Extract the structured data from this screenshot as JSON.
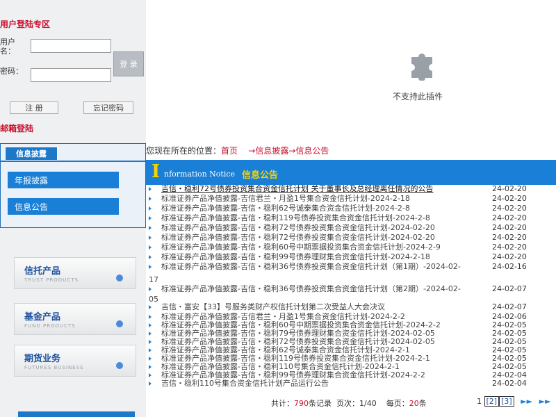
{
  "login": {
    "title": "用户登陆专区",
    "user_label": "用户名：",
    "pass_label": "密码：",
    "login_btn": "登 录",
    "register_btn": "注 册",
    "forgot_btn": "忘记密码",
    "mail_login": "邮箱登陆"
  },
  "plugin": {
    "message": "不支持此插件"
  },
  "sidebar": {
    "tab": "信息披露",
    "items": [
      {
        "label": "年报披露"
      },
      {
        "label": "信息公告"
      }
    ]
  },
  "products": [
    {
      "title": "信托产品",
      "subtitle": "TRUST PRODUCTS"
    },
    {
      "title": "基金产品",
      "subtitle": "FUND PRODUCTS"
    },
    {
      "title": "期货业务",
      "subtitle": "FUTURES BUSINESS"
    }
  ],
  "breadcrumb": {
    "prefix": "您现在所在的位置：",
    "home": "首页",
    "level1": "→信息披露",
    "level2": "→信息公告"
  },
  "notice": {
    "initial": "I",
    "en": "nformation Notice",
    "cn": "信息公告"
  },
  "notices": [
    {
      "title": "吉信・稳利72号债券投资集合资金信托计划 关于董事长及总经理离任情况的公告",
      "date": "24-02-20"
    },
    {
      "title": "标准证券产品净值披露-吉信君兰・月盈1号集合资金信托计划-2024-2-18",
      "date": "24-02-20"
    },
    {
      "title": "标准证券产品净值披露-吉信・稳利62号诚泰集合资金信托计划-2024-2-8",
      "date": "24-02-20"
    },
    {
      "title": "标准证券产品净值披露-吉信・稳利119号债券投资集合资金信托计划-2024-2-8",
      "date": "24-02-20"
    },
    {
      "title": "标准证券产品净值披露-吉信・稳利72号债券投资集合资金信托计划-2024-02-20",
      "date": "24-02-20"
    },
    {
      "title": "标准证券产品净值披露-吉信・稳利72号债券投资集合资金信托计划-2024-02-20",
      "date": "24-02-20"
    },
    {
      "title": "标准证券产品净值披露-吉信・稳利60号中期票据投资集合资金信托计划-2024-2-9",
      "date": "24-02-20"
    },
    {
      "title": "标准证券产品净值披露-吉信・稳利99号债券理财集合资金信托计划-2024-2-18",
      "date": "24-02-20"
    },
    {
      "title": "标准证券产品净值披露-吉信・稳利36号债券投资集合资金信托计划（第1期）-2024-02-",
      "date": "24-02-16"
    },
    {
      "title": "标准证券产品净值披露-吉信・稳利36号债券投资集合资金信托计划（第2期）-2024-02-",
      "date": "24-02-07"
    },
    {
      "title": "吉信・富安【33】号服务类财产权信托计划第二次受益人大会决议",
      "date": "24-02-07"
    },
    {
      "title": "标准证券产品净值披露-吉信君兰・月盈1号集合资金信托计划-2024-2-2",
      "date": "24-02-06"
    },
    {
      "title": "标准证券产品净值披露-吉信・稳利60号中期票据投资集合资金信托计划-2024-2-2",
      "date": "24-02-05"
    },
    {
      "title": "标准证券产品净值披露-吉信・稳利79号债券理财集合资金信托计划-2024-02-05",
      "date": "24-02-05"
    },
    {
      "title": "标准证券产品净值披露-吉信・稳利72号债券投资集合资金信托计划-2024-02-05",
      "date": "24-02-05"
    },
    {
      "title": "标准证券产品净值披露-吉信・稳利62号诚泰集合资金信托计划-2024-2-1",
      "date": "24-02-05"
    },
    {
      "title": "标准证券产品净值披露-吉信・稳利119号债券投资集合资金信托计划-2024-2-1",
      "date": "24-02-05"
    },
    {
      "title": "标准证券产品净值披露-吉信・稳利110号集合资金信托计划-2024-2-1",
      "date": "24-02-05"
    },
    {
      "title": "标准证券产品净值披露-吉信・稳利99号债券理财集合资金信托计划-2024-2-2",
      "date": "24-02-04"
    },
    {
      "title": "吉信・稳利110号集合资金信托计划产品运行公告",
      "date": "24-02-04"
    }
  ],
  "orphans": [
    "17",
    "05"
  ],
  "footer": {
    "total_prefix": "共计：",
    "total": "790",
    "total_suffix": "条记录",
    "page_prefix": "页次：",
    "page": "1/40",
    "per_prefix": "每页：",
    "per": "20",
    "per_suffix": "条",
    "pages": [
      "[2]",
      "[3]"
    ],
    "prev": "1",
    "next_icon": "►►",
    "last_icon": "►►"
  },
  "colors": {
    "accent": "#1a7fd6",
    "red": "#c8102e",
    "yellow": "#f5d300"
  }
}
